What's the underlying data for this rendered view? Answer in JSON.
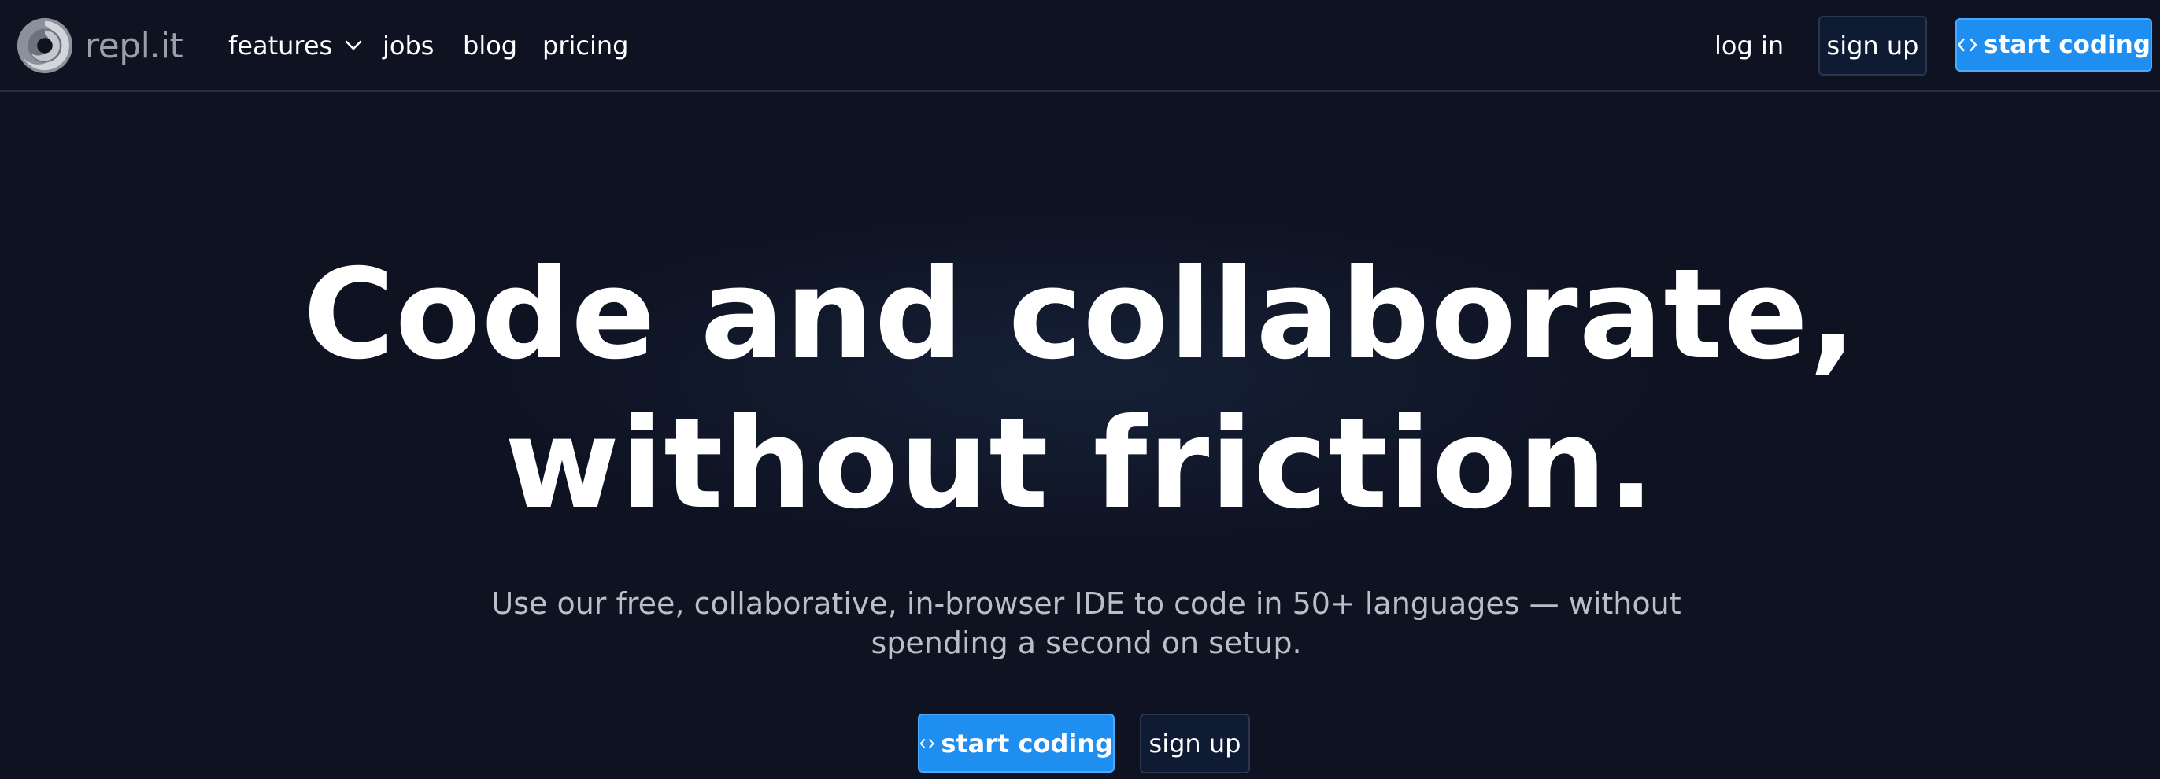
{
  "nav": {
    "logo_text": "repl.it",
    "features": "features",
    "jobs": "jobs",
    "blog": "blog",
    "pricing": "pricing",
    "login": "log in",
    "signup": "sign up",
    "start_coding": "start coding"
  },
  "hero": {
    "headline_line1": "Code and collaborate,",
    "headline_line2": "without friction.",
    "subtitle_line1": "Use our free, collaborative, in-browser IDE to code in 50+ languages — without",
    "subtitle_line2": "spending a second on setup.",
    "start_coding": "start coding",
    "signup": "sign up"
  },
  "colors": {
    "background": "#0e1221",
    "accent": "#1f8ef1",
    "dark_button": "#0f1b33",
    "subtitle": "#b9bec8"
  },
  "icons": [
    "replit-logo-icon",
    "chevron-down-icon",
    "code-brackets-icon"
  ]
}
